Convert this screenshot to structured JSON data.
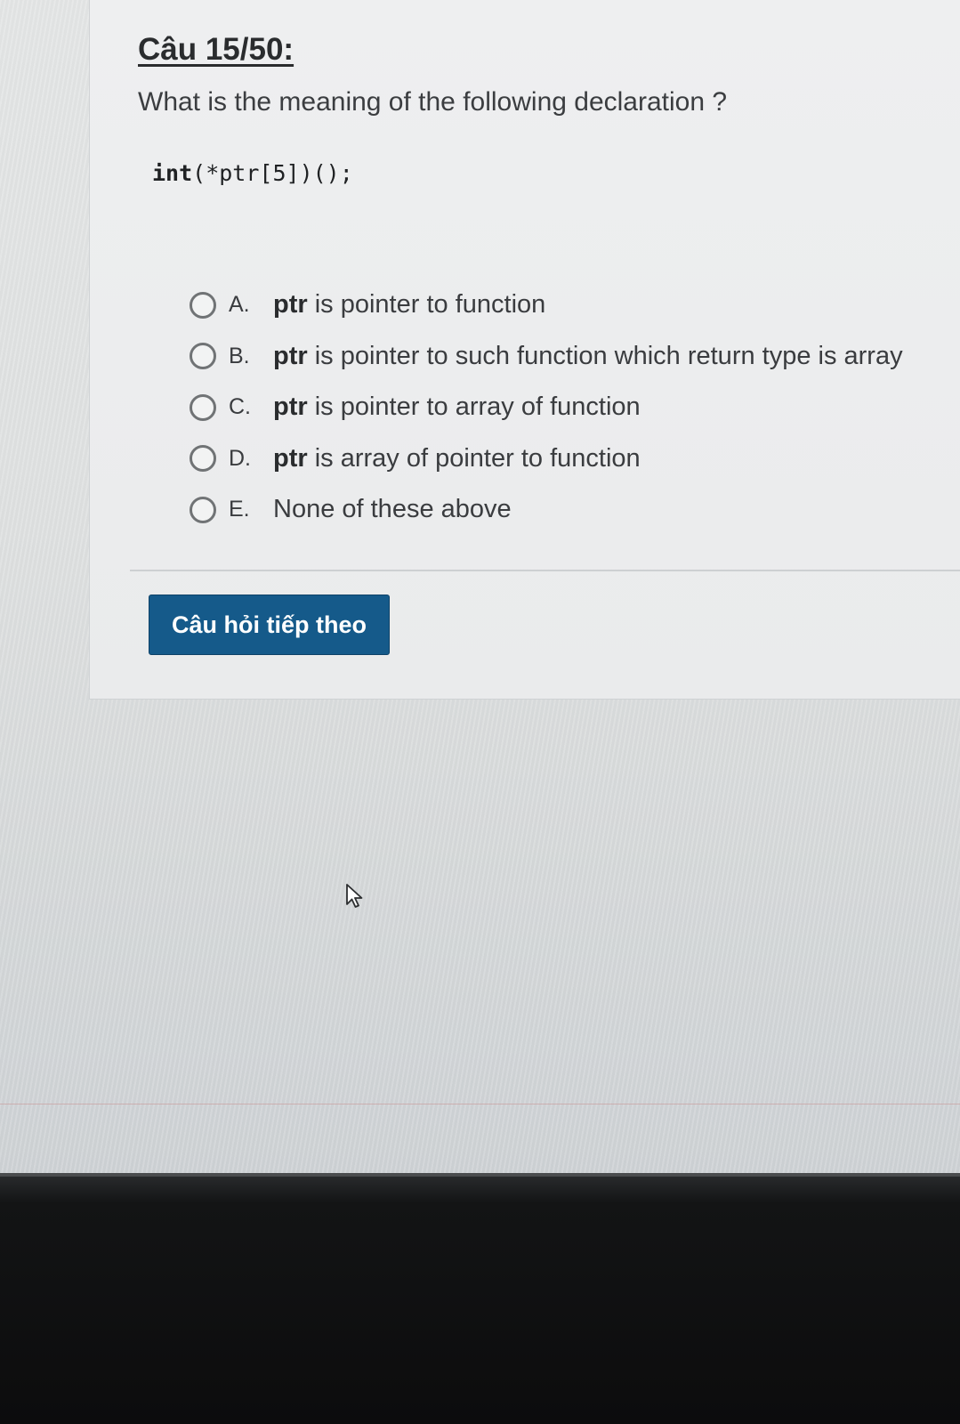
{
  "question": {
    "title": "Câu 15/50:",
    "text": "What is the meaning of the following declaration ?",
    "code_keyword": "int",
    "code_rest": "(*ptr[5])();"
  },
  "options": [
    {
      "letter": "A.",
      "keyword": "ptr",
      "text": " is pointer to function"
    },
    {
      "letter": "B.",
      "keyword": "ptr",
      "text": " is pointer to such function which return type is array"
    },
    {
      "letter": "C.",
      "keyword": "ptr",
      "text": " is pointer to array of function"
    },
    {
      "letter": "D.",
      "keyword": "ptr",
      "text": " is array of pointer to function"
    },
    {
      "letter": "E.",
      "keyword": "",
      "text": "None of these above"
    }
  ],
  "next_button": {
    "label": "Câu hỏi tiếp theo"
  },
  "colors": {
    "button_bg": "#155a8a",
    "button_text": "#ffffff",
    "text": "#3a3c3f"
  },
  "icons": {
    "cursor": "mouse-pointer-icon",
    "radio": "radio-unchecked-icon"
  }
}
